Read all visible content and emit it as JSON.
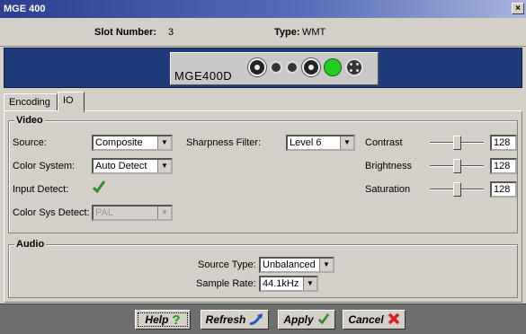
{
  "window": {
    "title": "MGE 400",
    "close_label": "×"
  },
  "info": {
    "slot_label": "Slot Number:",
    "slot_value": "3",
    "type_label": "Type:",
    "type_value": "WMT"
  },
  "device": {
    "name": "MGE400D"
  },
  "tabs": [
    {
      "label": "Encoding",
      "active": false
    },
    {
      "label": "IO",
      "active": true
    }
  ],
  "video": {
    "legend": "Video",
    "source_label": "Source:",
    "source_value": "Composite",
    "color_system_label": "Color System:",
    "color_system_value": "Auto Detect",
    "input_detect_label": "Input Detect:",
    "input_detect_ok": true,
    "color_sys_detect_label": "Color Sys Detect:",
    "color_sys_detect_value": "PAL",
    "sharpness_label": "Sharpness Filter:",
    "sharpness_value": "Level 6",
    "contrast_label": "Contrast",
    "contrast_value": "128",
    "brightness_label": "Brightness",
    "brightness_value": "128",
    "saturation_label": "Saturation",
    "saturation_value": "128",
    "slider_level": 0.5
  },
  "audio": {
    "legend": "Audio",
    "source_type_label": "Source Type:",
    "source_type_value": "Unbalanced",
    "sample_rate_label": "Sample Rate:",
    "sample_rate_value": "44.1kHz"
  },
  "footer": {
    "help_label": "Help",
    "refresh_label": "Refresh",
    "apply_label": "Apply",
    "cancel_label": "Cancel"
  },
  "colors": {
    "banner": "#1f3a78",
    "footer": "#6e6e6e",
    "check": "#2e8b2e",
    "cancel_x": "#d42020",
    "help_q": "#1a9a1a",
    "led": "#22cc22"
  }
}
